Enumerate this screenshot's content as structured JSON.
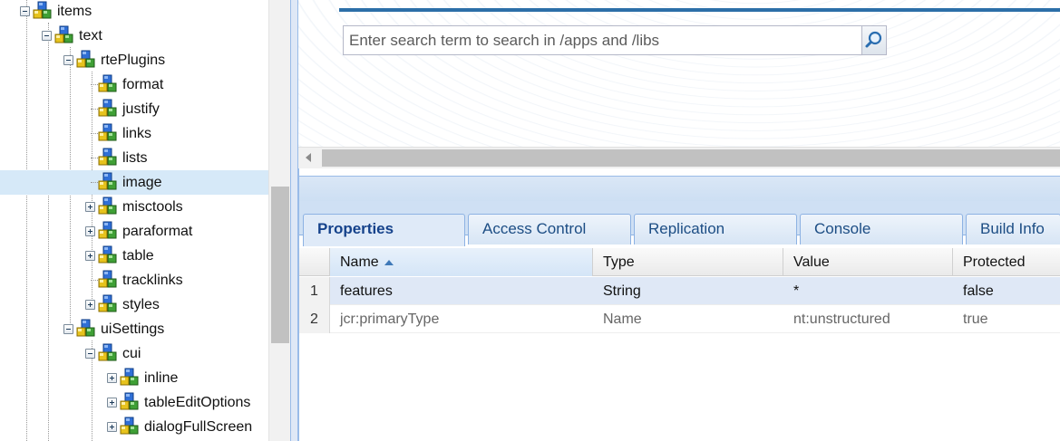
{
  "tree": {
    "nodes": [
      {
        "label": "items",
        "depth": 0,
        "toggle": "minus",
        "selected": false
      },
      {
        "label": "text",
        "depth": 1,
        "toggle": "minus",
        "selected": false
      },
      {
        "label": "rtePlugins",
        "depth": 2,
        "toggle": "minus",
        "selected": false
      },
      {
        "label": "format",
        "depth": 3,
        "toggle": "none",
        "selected": false
      },
      {
        "label": "justify",
        "depth": 3,
        "toggle": "none",
        "selected": false
      },
      {
        "label": "links",
        "depth": 3,
        "toggle": "none",
        "selected": false
      },
      {
        "label": "lists",
        "depth": 3,
        "toggle": "none",
        "selected": false
      },
      {
        "label": "image",
        "depth": 3,
        "toggle": "none",
        "selected": true
      },
      {
        "label": "misctools",
        "depth": 3,
        "toggle": "plus",
        "selected": false
      },
      {
        "label": "paraformat",
        "depth": 3,
        "toggle": "plus",
        "selected": false
      },
      {
        "label": "table",
        "depth": 3,
        "toggle": "plus",
        "selected": false
      },
      {
        "label": "tracklinks",
        "depth": 3,
        "toggle": "none",
        "selected": false
      },
      {
        "label": "styles",
        "depth": 3,
        "toggle": "plus",
        "selected": false
      },
      {
        "label": "uiSettings",
        "depth": 2,
        "toggle": "minus",
        "selected": false
      },
      {
        "label": "cui",
        "depth": 3,
        "toggle": "minus",
        "selected": false
      },
      {
        "label": "inline",
        "depth": 4,
        "toggle": "plus",
        "selected": false
      },
      {
        "label": "tableEditOptions",
        "depth": 4,
        "toggle": "plus",
        "selected": false
      },
      {
        "label": "dialogFullScreen",
        "depth": 4,
        "toggle": "plus",
        "selected": false
      }
    ],
    "node_icon": "jcr-node-cubes-icon"
  },
  "search": {
    "placeholder": "Enter search term to search in /apps and /libs",
    "value": "",
    "button_icon": "magnifier-icon"
  },
  "tabs": [
    {
      "label": "Properties",
      "active": true
    },
    {
      "label": "Access Control",
      "active": false
    },
    {
      "label": "Replication",
      "active": false
    },
    {
      "label": "Console",
      "active": false
    },
    {
      "label": "Build Info",
      "active": false
    }
  ],
  "properties_grid": {
    "columns": [
      "Name",
      "Type",
      "Value",
      "Protected"
    ],
    "sorted_column": "Name",
    "sort_direction": "ascending",
    "rows": [
      {
        "num": "1",
        "name": "features",
        "type": "String",
        "value": "*",
        "protected": "false",
        "selected": true
      },
      {
        "num": "2",
        "name": "jcr:primaryType",
        "type": "Name",
        "value": "nt:unstructured",
        "protected": "true",
        "selected": false
      }
    ]
  },
  "colors": {
    "selection": "#d6e9f8",
    "accent_line": "#2c6fa8",
    "tab_text": "#15428b"
  }
}
